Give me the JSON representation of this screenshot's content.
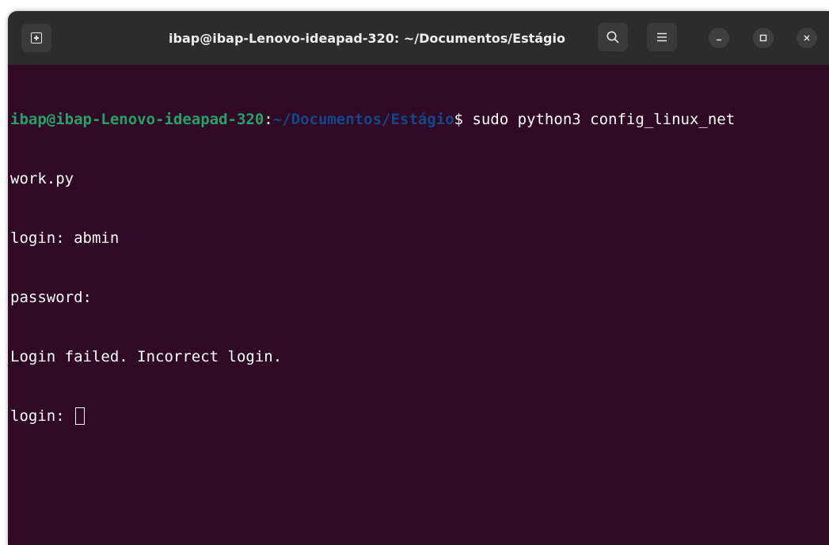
{
  "window": {
    "title": "ibap@ibap-Lenovo-ideapad-320: ~/Documentos/Estágio"
  },
  "toolbar": {
    "new_tab_icon": "new-tab-icon",
    "search_icon": "search-icon",
    "search_glyph": "⌕",
    "menu_icon": "hamburger-menu-icon",
    "menu_glyph": "≡",
    "minimize_glyph": "–",
    "maximize_glyph": "□",
    "close_glyph": "✕"
  },
  "terminal": {
    "prompt_user": "ibap@ibap-Lenovo-ideapad-320",
    "prompt_sep": ":",
    "prompt_path": "~/Documentos/Estágio",
    "prompt_symbol": "$",
    "command_line1": " sudo python3 config_linux_net",
    "command_line2": "work.py",
    "line_login1": "login: abmin",
    "line_password": "password:",
    "line_failed": "Login failed. Incorrect login.",
    "line_login2": "login: "
  },
  "colors": {
    "background": "#300a24",
    "titlebar": "#2c2c2c",
    "prompt_user": "#26a269",
    "prompt_path": "#12488b",
    "text": "#ffffff"
  }
}
